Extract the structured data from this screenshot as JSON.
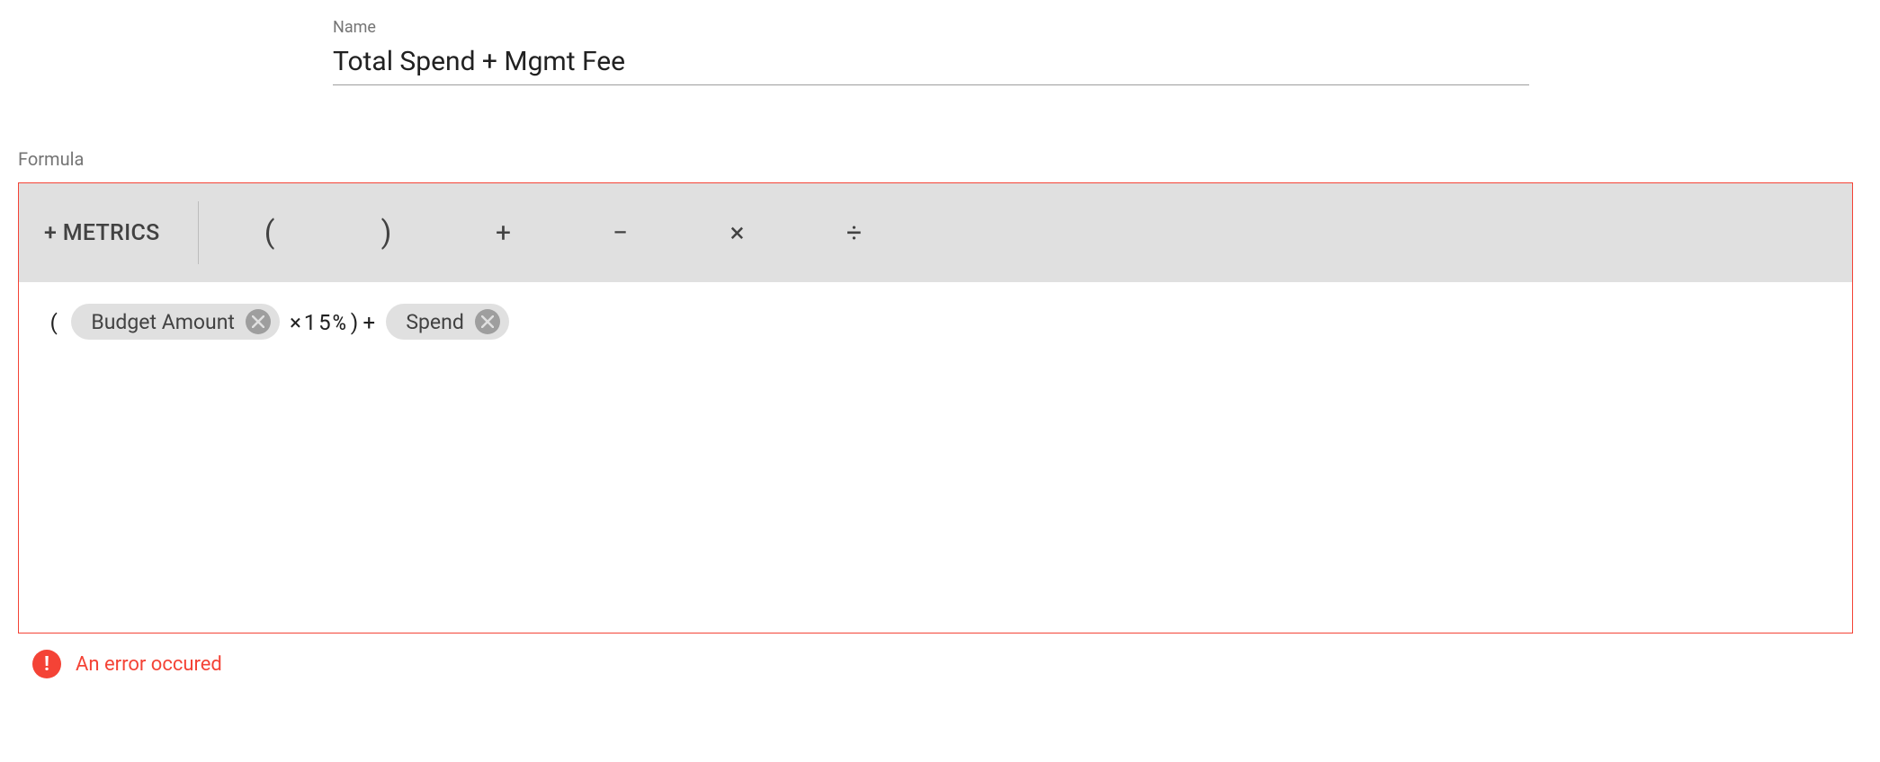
{
  "name_field": {
    "label": "Name",
    "value": "Total Spend + Mgmt Fee"
  },
  "formula_section": {
    "label": "Formula",
    "toolbar": {
      "metrics_button": "+ METRICS",
      "open_paren": "(",
      "close_paren": ")",
      "plus": "+",
      "minus": "−",
      "multiply": "×",
      "divide": "÷"
    },
    "tokens": {
      "open_paren": "(",
      "chip1": "Budget Amount",
      "times_fifteen_close_plus": "×15%)+",
      "chip2": "Spend"
    }
  },
  "error": {
    "icon": "!",
    "message": "An error occured"
  }
}
